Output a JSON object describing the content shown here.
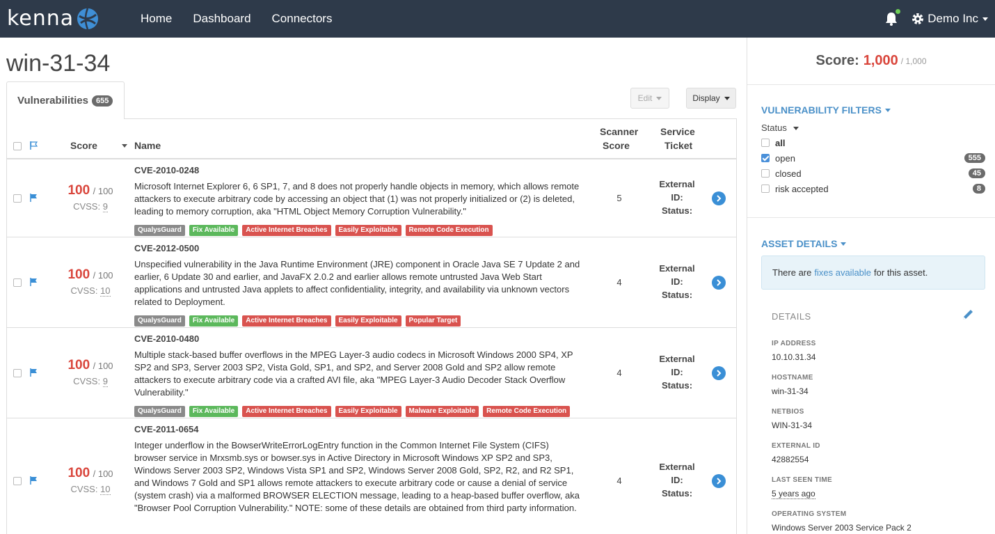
{
  "nav": {
    "logo_text": "kenna",
    "links": [
      "Home",
      "Dashboard",
      "Connectors"
    ],
    "account": "Demo Inc"
  },
  "page": {
    "title": "win-31-34",
    "tab_label": "Vulnerabilities",
    "tab_count": "655",
    "edit_label": "Edit",
    "display_label": "Display"
  },
  "table": {
    "headers": {
      "score": "Score",
      "name": "Name",
      "scanner_score_1": "Scanner",
      "scanner_score_2": "Score",
      "ticket_1": "Service",
      "ticket_2": "Ticket"
    },
    "ticket_lines": [
      "External",
      "ID:",
      "Status:"
    ],
    "rows": [
      {
        "score": "100",
        "score_max": "/ 100",
        "cvss_label": "CVSS:",
        "cvss": "9",
        "cve": "CVE-2010-0248",
        "description": "Microsoft Internet Explorer 6, 6 SP1, 7, and 8 does not properly handle objects in memory, which allows remote attackers to execute arbitrary code by accessing an object that (1) was not properly initialized or (2) is deleted, leading to memory corruption, aka \"HTML Object Memory Corruption Vulnerability.\"",
        "tags": [
          {
            "label": "QualysGuard",
            "color": "grey"
          },
          {
            "label": "Fix Available",
            "color": "green"
          },
          {
            "label": "Active Internet Breaches",
            "color": "red"
          },
          {
            "label": "Easily Exploitable",
            "color": "red"
          },
          {
            "label": "Remote Code Execution",
            "color": "red"
          }
        ],
        "scanner_score": "5"
      },
      {
        "score": "100",
        "score_max": "/ 100",
        "cvss_label": "CVSS:",
        "cvss": "10",
        "cve": "CVE-2012-0500",
        "description": "Unspecified vulnerability in the Java Runtime Environment (JRE) component in Oracle Java SE 7 Update 2 and earlier, 6 Update 30 and earlier, and JavaFX 2.0.2 and earlier allows remote untrusted Java Web Start applications and untrusted Java applets to affect confidentiality, integrity, and availability via unknown vectors related to Deployment.",
        "tags": [
          {
            "label": "QualysGuard",
            "color": "grey"
          },
          {
            "label": "Fix Available",
            "color": "green"
          },
          {
            "label": "Active Internet Breaches",
            "color": "red"
          },
          {
            "label": "Easily Exploitable",
            "color": "red"
          },
          {
            "label": "Popular Target",
            "color": "red"
          }
        ],
        "scanner_score": "4"
      },
      {
        "score": "100",
        "score_max": "/ 100",
        "cvss_label": "CVSS:",
        "cvss": "9",
        "cve": "CVE-2010-0480",
        "description": "Multiple stack-based buffer overflows in the MPEG Layer-3 audio codecs in Microsoft Windows 2000 SP4, XP SP2 and SP3, Server 2003 SP2, Vista Gold, SP1, and SP2, and Server 2008 Gold and SP2 allow remote attackers to execute arbitrary code via a crafted AVI file, aka \"MPEG Layer-3 Audio Decoder Stack Overflow Vulnerability.\"",
        "tags": [
          {
            "label": "QualysGuard",
            "color": "grey"
          },
          {
            "label": "Fix Available",
            "color": "green"
          },
          {
            "label": "Active Internet Breaches",
            "color": "red"
          },
          {
            "label": "Easily Exploitable",
            "color": "red"
          },
          {
            "label": "Malware Exploitable",
            "color": "red"
          },
          {
            "label": "Remote Code Execution",
            "color": "red"
          }
        ],
        "scanner_score": "4"
      },
      {
        "score": "100",
        "score_max": "/ 100",
        "cvss_label": "CVSS:",
        "cvss": "10",
        "cve": "CVE-2011-0654",
        "description": "Integer underflow in the BowserWriteErrorLogEntry function in the Common Internet File System (CIFS) browser service in Mrxsmb.sys or bowser.sys in Active Directory in Microsoft Windows XP SP2 and SP3, Windows Server 2003 SP2, Windows Vista SP1 and SP2, Windows Server 2008 Gold, SP2, R2, and R2 SP1, and Windows 7 Gold and SP1 allows remote attackers to execute arbitrary code or cause a denial of service (system crash) via a malformed BROWSER ELECTION message, leading to a heap-based buffer overflow, aka \"Browser Pool Corruption Vulnerability.\" NOTE: some of these details are obtained from third party information.",
        "tags": [
          {
            "label": "QualysGuard",
            "color": "grey"
          },
          {
            "label": "Fix Available",
            "color": "green"
          },
          {
            "label": "Active Internet Breaches",
            "color": "red"
          },
          {
            "label": "Easily Exploitable",
            "color": "red"
          },
          {
            "label": "Remote Code Execution",
            "color": "red"
          }
        ],
        "scanner_score": "4"
      }
    ]
  },
  "sidebar": {
    "score_label": "Score:",
    "score_value": "1,000",
    "score_max": "/ 1,000",
    "filters_title": "VULNERABILITY FILTERS",
    "status_label": "Status",
    "filters": [
      {
        "label": "all",
        "checked": false,
        "count": ""
      },
      {
        "label": "open",
        "checked": true,
        "count": "555"
      },
      {
        "label": "closed",
        "checked": false,
        "count": "45"
      },
      {
        "label": "risk accepted",
        "checked": false,
        "count": "8"
      }
    ],
    "asset_title": "ASSET DETAILS",
    "info_pre": "There are",
    "info_link": "fixes available",
    "info_post": "for this asset.",
    "details_title": "DETAILS",
    "details": [
      {
        "label": "IP ADDRESS",
        "value": "10.10.31.34"
      },
      {
        "label": "HOSTNAME",
        "value": "win-31-34"
      },
      {
        "label": "NETBIOS",
        "value": "WIN-31-34"
      },
      {
        "label": "EXTERNAL ID",
        "value": "42882554"
      },
      {
        "label": "LAST SEEN TIME",
        "value": "5 years ago"
      },
      {
        "label": "OPERATING SYSTEM",
        "value": "Windows Server 2003 Service Pack 2"
      }
    ]
  },
  "colors": {
    "navbar": "#2e3a4a",
    "accent_blue": "#4a90c8",
    "score_red": "#d9453b",
    "tag_green": "#5cb85c",
    "tag_red": "#d9534f",
    "tag_grey": "#8a8a8a"
  }
}
